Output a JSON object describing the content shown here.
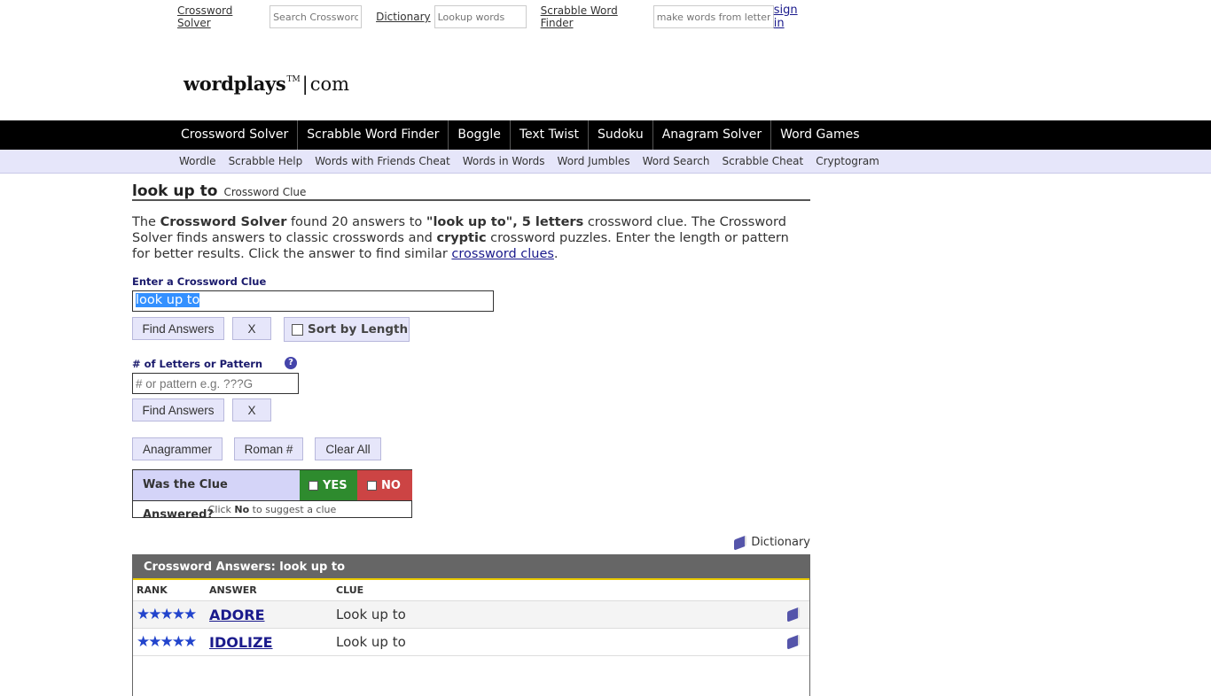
{
  "topbar": {
    "crossword_link": "Crossword Solver",
    "crossword_placeholder": "Search Crosswords",
    "dictionary_link": "Dictionary",
    "dictionary_placeholder": "Lookup words",
    "scrabble_link": "Scrabble Word Finder",
    "scrabble_placeholder": "make words from letters",
    "signin": "sign in"
  },
  "logo": {
    "brand": "wordplays",
    "tm": "TM",
    "sep": "|",
    "tld": "com"
  },
  "mainnav": [
    "Crossword Solver",
    "Scrabble Word Finder",
    "Boggle",
    "Text Twist",
    "Sudoku",
    "Anagram Solver",
    "Word Games"
  ],
  "subnav": [
    "Wordle",
    "Scrabble Help",
    "Words with Friends Cheat",
    "Words in Words",
    "Word Jumbles",
    "Word Search",
    "Scrabble Cheat",
    "Cryptogram"
  ],
  "page": {
    "title": "look up to",
    "subtitle": "Crossword Clue",
    "intro": {
      "p1": "The ",
      "b1": "Crossword Solver",
      "p2": " found 20 answers to ",
      "b2": "\"look up to\", 5 letters",
      "p3": " crossword clue. The Crossword Solver finds answers to classic crosswords and ",
      "b3": "cryptic",
      "p4": " crossword puzzles. Enter the length or pattern for better results. Click the answer to find similar ",
      "link": "crossword clues",
      "p5": "."
    }
  },
  "clue_form": {
    "label": "Enter a Crossword Clue",
    "value": "look up to",
    "find_label": "Find Answers",
    "clear_label": "X",
    "sort_label": "Sort by Length"
  },
  "pattern_form": {
    "label": "# of Letters or Pattern",
    "help": "?",
    "placeholder": "# or pattern e.g. ???G",
    "find_label": "Find Answers",
    "clear_label": "X"
  },
  "tools": {
    "anagrammer": "Anagrammer",
    "roman": "Roman #",
    "clear_all": "Clear All"
  },
  "answered": {
    "question": "Was the Clue Answered?",
    "yes": "YES",
    "no": "NO",
    "hint_pre": "Click ",
    "hint_bold": "No",
    "hint_post": " to suggest a clue"
  },
  "dictionary_link": "Dictionary",
  "answers": {
    "header": "Crossword Answers: look up to",
    "columns": {
      "rank": "RANK",
      "answer": "ANSWER",
      "clue": "CLUE"
    },
    "rows": [
      {
        "stars": "★★★★★",
        "rating": 5,
        "answer": "ADORE",
        "clue": "Look up to"
      },
      {
        "stars": "★★★★★",
        "rating": 5,
        "answer": "IDOLIZE",
        "clue": "Look up to"
      }
    ]
  }
}
